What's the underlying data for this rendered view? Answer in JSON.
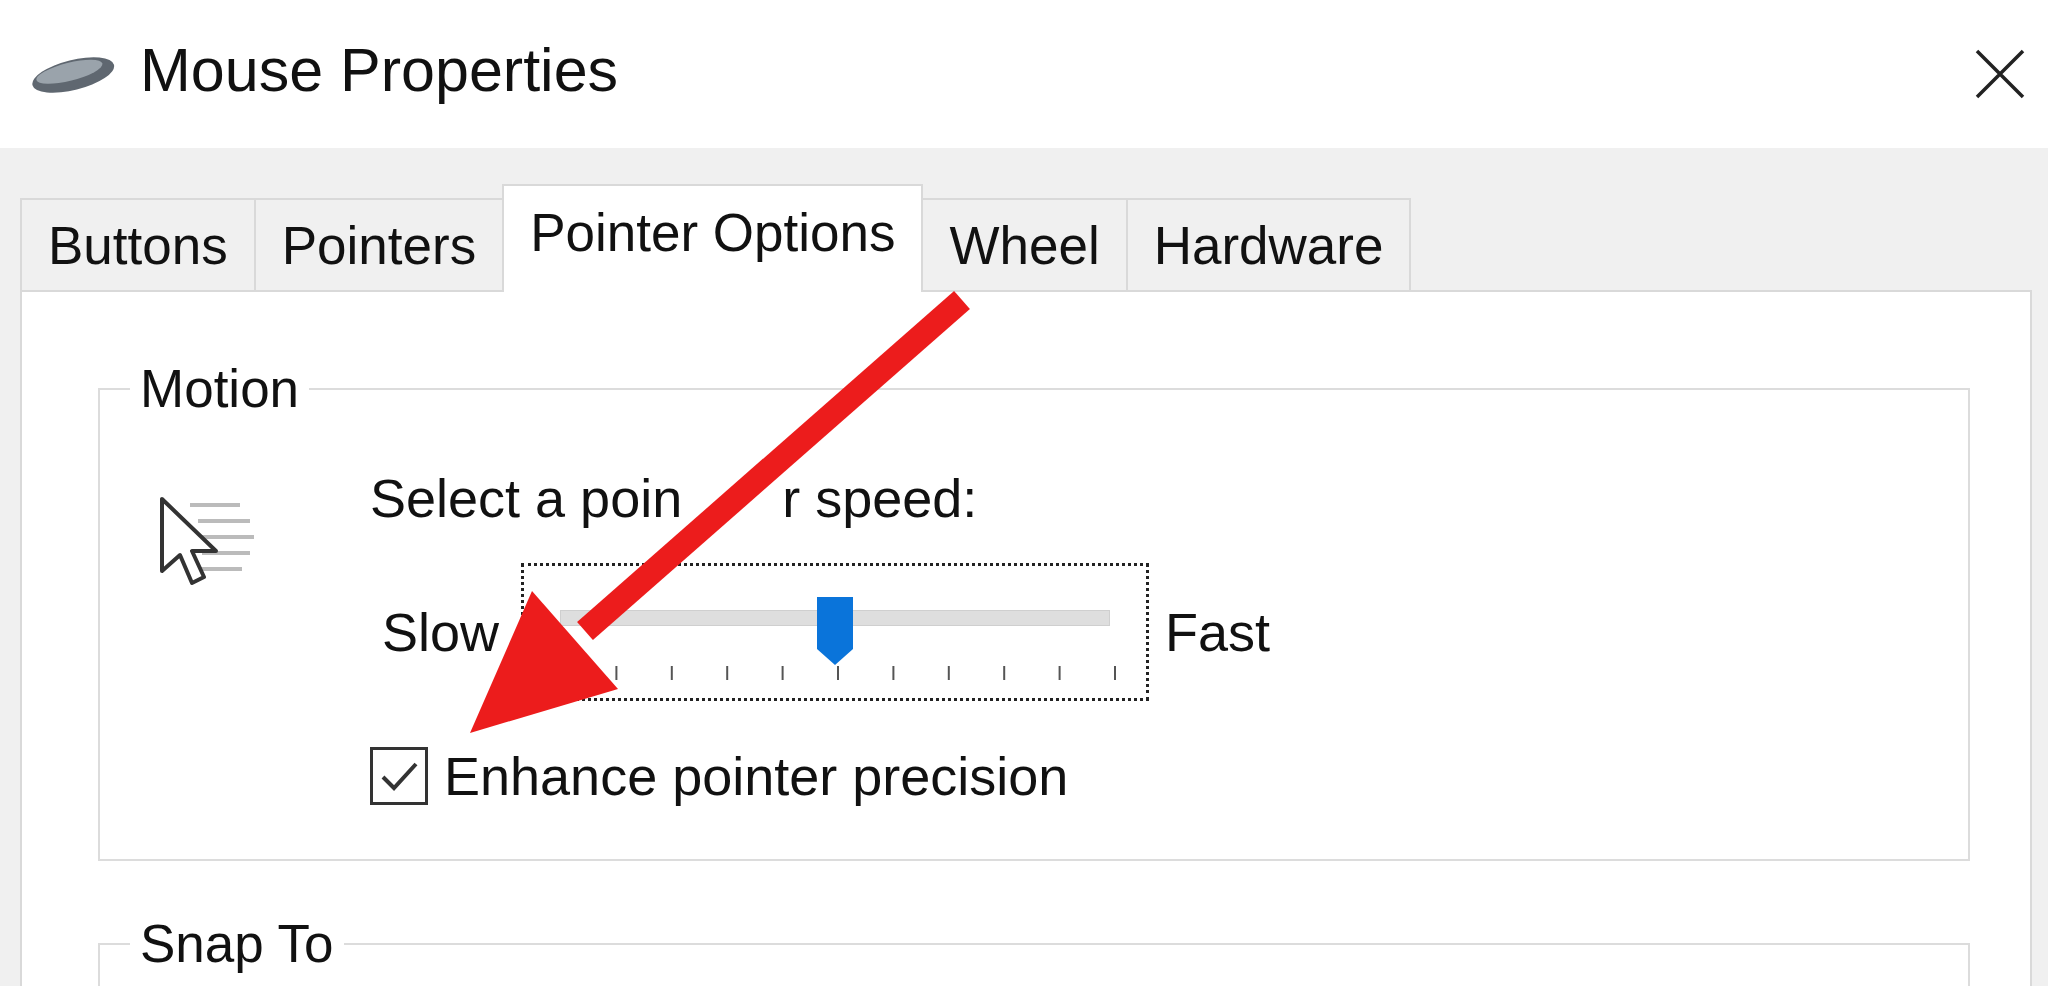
{
  "window": {
    "title": "Mouse Properties"
  },
  "tabs": [
    {
      "label": "Buttons",
      "selected": false
    },
    {
      "label": "Pointers",
      "selected": false
    },
    {
      "label": "Pointer Options",
      "selected": true
    },
    {
      "label": "Wheel",
      "selected": false
    },
    {
      "label": "Hardware",
      "selected": false
    }
  ],
  "motion": {
    "legend": "Motion",
    "speed_label_parts": [
      "Select a poin",
      "r speed:"
    ],
    "slow_label": "Slow",
    "fast_label": "Fast",
    "speed": {
      "level": 0.5
    },
    "enhance_precision": {
      "label": "Enhance pointer precision",
      "checked": true
    }
  },
  "snap_to": {
    "legend": "Snap To"
  }
}
